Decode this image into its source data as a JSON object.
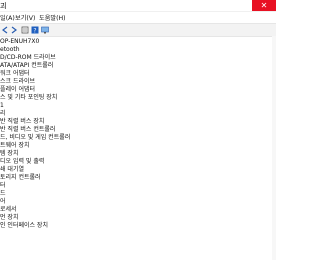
{
  "window": {
    "title": "괴",
    "close_glyph": "✕"
  },
  "menu": [
    "일(A)",
    "보기(V)",
    "도움말(H)"
  ],
  "toolbar": {
    "buttons": [
      "back-icon",
      "forward-icon",
      "properties-icon",
      "help-icon",
      "monitor-icon"
    ]
  },
  "tree": {
    "rows": [
      "OP-ENUH7X0",
      "etooth",
      "D/CD-ROM 드라이브",
      "ATA/ATAPI 컨트롤러",
      "워크 어댑터",
      "스크 드라이브",
      "플레이 어댑터",
      "스 및 기타 포인팅 장치",
      "1",
      "리",
      "반 직렬 버스 장치",
      "반 직렬 버스 컨트롤러",
      "드, 비디오 및 게임 컨트롤러",
      "트웨어 장치",
      "템 장치",
      "디오 입력 및 출력",
      "쇄 대기열",
      "토리지 컨트롤러",
      "터",
      "드",
      "어",
      "로세서",
      "먼 장치",
      "인 인터페이스 장치"
    ]
  },
  "colors": {
    "close": "#e81123",
    "toolbar": "#f3f3f3"
  }
}
